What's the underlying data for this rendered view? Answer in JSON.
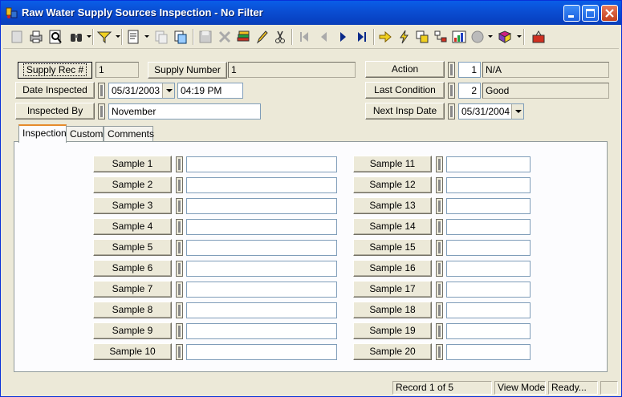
{
  "window": {
    "title": "Raw Water Supply Sources Inspection - No Filter"
  },
  "header": {
    "supply_rec_label": "Supply Rec #",
    "supply_rec_value": "1",
    "supply_number_label": "Supply Number",
    "supply_number_value": "1",
    "date_inspected_label": "Date Inspected",
    "date_inspected_value": "05/31/2003",
    "time_inspected_value": "04:19 PM",
    "inspected_by_label": "Inspected By",
    "inspected_by_value": "November",
    "action_label": "Action",
    "action_code": "1",
    "action_value": "N/A",
    "last_condition_label": "Last Condition",
    "last_condition_code": "2",
    "last_condition_value": "Good",
    "next_insp_label": "Next Insp Date",
    "next_insp_value": "05/31/2004"
  },
  "tabs": [
    "Inspection",
    "Custom",
    "Comments"
  ],
  "samples_left": [
    "Sample 1",
    "Sample 2",
    "Sample 3",
    "Sample 4",
    "Sample 5",
    "Sample 6",
    "Sample 7",
    "Sample 8",
    "Sample 9",
    "Sample 10"
  ],
  "samples_right": [
    "Sample 11",
    "Sample 12",
    "Sample 13",
    "Sample 14",
    "Sample 15",
    "Sample 16",
    "Sample 17",
    "Sample 18",
    "Sample 19",
    "Sample 20"
  ],
  "status": {
    "record": "Record 1 of 5",
    "mode": "View Mode",
    "state": "Ready..."
  },
  "toolbar_icons": [
    "new-record-icon",
    "print-icon",
    "print-preview-icon",
    "binoculars-icon",
    "filter-icon",
    "report-icon",
    "copy-icon",
    "paste-icon",
    "save-icon",
    "delete-icon",
    "stack-icon",
    "edit-pencil-icon",
    "cut-icon",
    "first-record-icon",
    "prev-record-icon",
    "next-record-icon",
    "last-record-icon",
    "goto-icon",
    "lightning-icon",
    "attach-icon",
    "tree-icon",
    "chart-icon",
    "globe-icon",
    "book-icon",
    "exit-icon"
  ]
}
